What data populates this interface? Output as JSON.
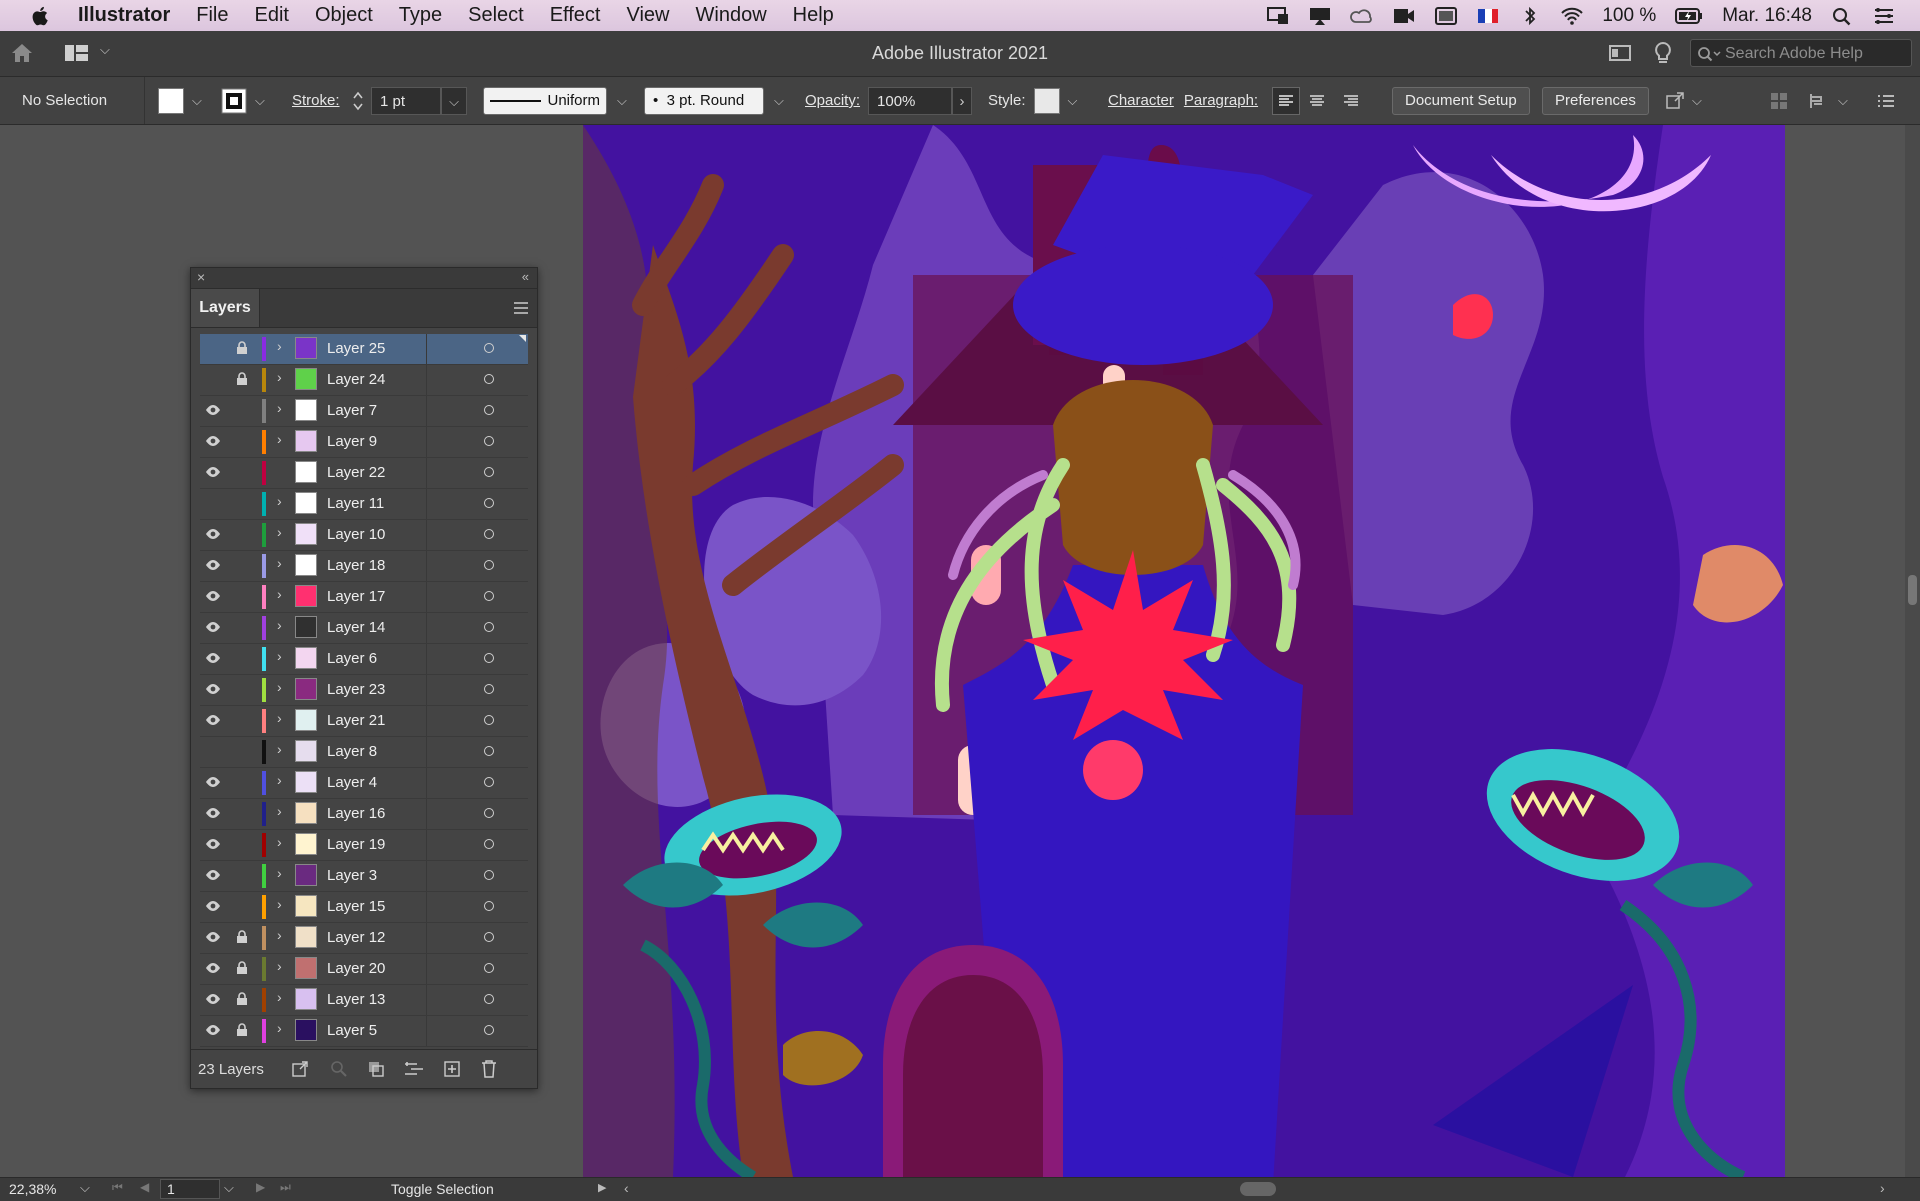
{
  "menubar": {
    "app_name": "Illustrator",
    "items": [
      "File",
      "Edit",
      "Object",
      "Type",
      "Select",
      "Effect",
      "View",
      "Window",
      "Help"
    ],
    "battery": "100 %",
    "clock": "Mar. 16:48"
  },
  "titlebar": {
    "title": "Adobe Illustrator 2021",
    "search_placeholder": "Search Adobe Help"
  },
  "controlbar": {
    "selection": "No Selection",
    "stroke_label": "Stroke:",
    "stroke_value": "1 pt",
    "profile": "Uniform",
    "brush": "3 pt. Round",
    "opacity_label": "Opacity:",
    "opacity_value": "100%",
    "style_label": "Style:",
    "character": "Character",
    "paragraph": "Paragraph:",
    "doc_setup": "Document Setup",
    "preferences": "Preferences"
  },
  "layers_panel": {
    "tab": "Layers",
    "footer_count": "23 Layers",
    "layers": [
      {
        "name": "Layer 25",
        "visible": false,
        "locked": true,
        "color": "#8a2be2",
        "thumb": "#7a34c8",
        "selected": true
      },
      {
        "name": "Layer 24",
        "visible": false,
        "locked": true,
        "color": "#b8860b",
        "thumb": "#5fd14a"
      },
      {
        "name": "Layer 7",
        "visible": true,
        "locked": false,
        "color": "#808080",
        "thumb": "#ffffff"
      },
      {
        "name": "Layer 9",
        "visible": true,
        "locked": false,
        "color": "#ff7f00",
        "thumb": "#e6c8f0"
      },
      {
        "name": "Layer 22",
        "visible": true,
        "locked": false,
        "color": "#c00040",
        "thumb": "#ffffff"
      },
      {
        "name": "Layer 11",
        "visible": false,
        "locked": false,
        "color": "#00b0b0",
        "thumb": "#ffffff"
      },
      {
        "name": "Layer 10",
        "visible": true,
        "locked": false,
        "color": "#1e9e3c",
        "thumb": "#f0e0f8"
      },
      {
        "name": "Layer 18",
        "visible": true,
        "locked": false,
        "color": "#9a9ae6",
        "thumb": "#ffffff"
      },
      {
        "name": "Layer 17",
        "visible": true,
        "locked": false,
        "color": "#ff80c0",
        "thumb": "#ff3070"
      },
      {
        "name": "Layer 14",
        "visible": true,
        "locked": false,
        "color": "#a040e0",
        "thumb": "#303030"
      },
      {
        "name": "Layer 6",
        "visible": true,
        "locked": false,
        "color": "#40e0f0",
        "thumb": "#f3d6f0"
      },
      {
        "name": "Layer 23",
        "visible": true,
        "locked": false,
        "color": "#a0e040",
        "thumb": "#8a2a80"
      },
      {
        "name": "Layer 21",
        "visible": true,
        "locked": false,
        "color": "#ff8080",
        "thumb": "#e0f0f0"
      },
      {
        "name": "Layer 8",
        "visible": false,
        "locked": false,
        "color": "#101010",
        "thumb": "#e6ddee"
      },
      {
        "name": "Layer 4",
        "visible": true,
        "locked": false,
        "color": "#5050e0",
        "thumb": "#ece0f6"
      },
      {
        "name": "Layer 16",
        "visible": true,
        "locked": false,
        "color": "#20208a",
        "thumb": "#f6e0c0"
      },
      {
        "name": "Layer 19",
        "visible": true,
        "locked": false,
        "color": "#a00000",
        "thumb": "#fff4d0"
      },
      {
        "name": "Layer 3",
        "visible": true,
        "locked": false,
        "color": "#40d040",
        "thumb": "#6a2a80"
      },
      {
        "name": "Layer 15",
        "visible": true,
        "locked": false,
        "color": "#ffa000",
        "thumb": "#f6e6c0"
      },
      {
        "name": "Layer 12",
        "visible": true,
        "locked": true,
        "color": "#c09060",
        "thumb": "#f0e0c8"
      },
      {
        "name": "Layer 20",
        "visible": true,
        "locked": true,
        "color": "#6a7a30",
        "thumb": "#c07070"
      },
      {
        "name": "Layer 13",
        "visible": true,
        "locked": true,
        "color": "#a04000",
        "thumb": "#d8c0f0"
      },
      {
        "name": "Layer 5",
        "visible": true,
        "locked": true,
        "color": "#e040e0",
        "thumb": "#2a1060"
      }
    ]
  },
  "statusbar": {
    "zoom": "22,38%",
    "artboard": "1",
    "tool": "Toggle Selection"
  },
  "colors": {
    "accent_selected": "#4b6585",
    "canvas_bg": "#4a14a8"
  }
}
